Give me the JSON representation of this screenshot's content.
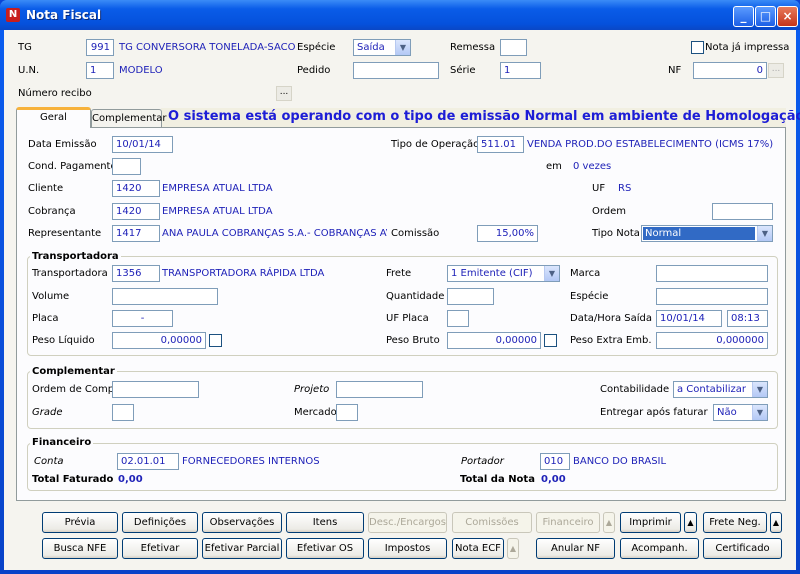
{
  "window": {
    "title": "Nota Fiscal",
    "icon": "app-logo-icon"
  },
  "header": {
    "tg_label": "TG",
    "tg_code": "991",
    "tg_name": "TG CONVERSORA TONELADA-SACO",
    "especie_label": "Espécie",
    "especie_value": "Saída",
    "remessa_label": "Remessa",
    "remessa_value": "",
    "nota_impressa_label": "Nota já impressa",
    "nota_impressa_checked": false,
    "un_label": "U.N.",
    "un_code": "1",
    "un_name": "MODELO",
    "pedido_label": "Pedido",
    "pedido_value": "",
    "serie_label": "Série",
    "serie_value": "1",
    "nf_label": "NF",
    "nf_value": "0",
    "recibo_label": "Número recibo",
    "ellipsis": "..."
  },
  "tabs": [
    {
      "label": "Geral",
      "active": true
    },
    {
      "label": "Complementar",
      "active": false
    }
  ],
  "status_message": "O sistema está operando com o tipo de emissão Normal em ambiente de Homologação",
  "geral": {
    "data_emissao_label": "Data Emissão",
    "data_emissao": "10/01/14",
    "tipo_operacao_label": "Tipo de Operação",
    "tipo_operacao_code": "511.01",
    "tipo_operacao_desc": "VENDA PROD.DO ESTABELECIMENTO (ICMS 17%)",
    "cond_pagamento_label": "Cond. Pagamento",
    "cond_pagamento": "",
    "em_label": "em",
    "vezes": "0 vezes",
    "cliente_label": "Cliente",
    "cliente_code": "1420",
    "cliente_name": "EMPRESA ATUAL LTDA",
    "uf_label": "UF",
    "uf_value": "RS",
    "cobranca_label": "Cobrança",
    "cobranca_code": "1420",
    "cobranca_name": "EMPRESA ATUAL LTDA",
    "ordem_label": "Ordem",
    "ordem_value": "",
    "representante_label": "Representante",
    "representante_code": "1417",
    "representante_name": "ANA PAULA COBRANÇAS S.A.-  COBRANÇAS AVIÂ",
    "comissao_label": "Comissão",
    "comissao_value": "15,00%",
    "tipo_nota_label": "Tipo Nota",
    "tipo_nota_value": "Normal"
  },
  "transportadora": {
    "title": "Transportadora",
    "transportadora_label": "Transportadora",
    "transportadora_code": "1356",
    "transportadora_name": "TRANSPORTADORA RÁPIDA LTDA",
    "frete_label": "Frete",
    "frete_value": "1 Emitente (CIF)",
    "marca_label": "Marca",
    "marca_value": "",
    "volume_label": "Volume",
    "volume_value": "",
    "quantidade_label": "Quantidade",
    "quantidade_value": "",
    "especie_label": "Espécie",
    "especie_value": "",
    "placa_label": "Placa",
    "placa_value": "-",
    "uf_placa_label": "UF Placa",
    "uf_placa_value": "",
    "data_hora_label": "Data/Hora Saída",
    "data_saida": "10/01/14",
    "hora_saida": "08:13",
    "peso_liquido_label": "Peso Líquido",
    "peso_liquido": "0,00000",
    "peso_bruto_label": "Peso Bruto",
    "peso_bruto": "0,00000",
    "peso_extra_label": "Peso Extra Emb.",
    "peso_extra": "0,000000"
  },
  "complementar": {
    "title": "Complementar",
    "ordem_compra_label": "Ordem de Compra",
    "ordem_compra": "",
    "projeto_label": "Projeto",
    "projeto": "",
    "contabilidade_label": "Contabilidade",
    "contabilidade": "a Contabilizar",
    "grade_label": "Grade",
    "grade": "",
    "mercado_label": "Mercado",
    "mercado": "",
    "entregar_label": "Entregar após faturar",
    "entregar": "Não"
  },
  "financeiro": {
    "title": "Financeiro",
    "conta_label": "Conta",
    "conta_code": "02.01.01",
    "conta_name": "FORNECEDORES INTERNOS",
    "portador_label": "Portador",
    "portador_code": "010",
    "portador_name": "BANCO DO BRASIL",
    "total_faturado_label": "Total Faturado",
    "total_faturado": "0,00",
    "total_nota_label": "Total da Nota",
    "total_nota": "0,00"
  },
  "buttons": [
    {
      "label": "Prévia",
      "enabled": true,
      "row": 1
    },
    {
      "label": "Definições",
      "enabled": true,
      "row": 1
    },
    {
      "label": "Observações",
      "enabled": true,
      "row": 1
    },
    {
      "label": "Itens",
      "enabled": true,
      "row": 1
    },
    {
      "label": "Desc./Encargos",
      "enabled": false,
      "row": 1
    },
    {
      "label": "Comissões",
      "enabled": false,
      "row": 1
    },
    {
      "label": "Financeiro",
      "enabled": false,
      "row": 1
    },
    {
      "label": "▲",
      "enabled": false,
      "row": 1
    },
    {
      "label": "Imprimir",
      "enabled": true,
      "row": 1
    },
    {
      "label": "▲",
      "enabled": true,
      "row": 1
    },
    {
      "label": "Frete Neg.",
      "enabled": true,
      "row": 1
    },
    {
      "label": "▲",
      "enabled": true,
      "row": 1
    },
    {
      "label": "Busca NFE",
      "enabled": true,
      "row": 2
    },
    {
      "label": "Efetivar",
      "enabled": true,
      "row": 2
    },
    {
      "label": "Efetivar Parcial",
      "enabled": true,
      "row": 2
    },
    {
      "label": "Efetivar OS",
      "enabled": true,
      "row": 2
    },
    {
      "label": "Impostos",
      "enabled": true,
      "row": 2
    },
    {
      "label": "Nota ECF",
      "enabled": true,
      "row": 2
    },
    {
      "label": "▲",
      "enabled": false,
      "row": 2
    },
    {
      "label": "Anular NF",
      "enabled": true,
      "row": 2
    },
    {
      "label": "Acompanh.",
      "enabled": true,
      "row": 2
    },
    {
      "label": "Certificado",
      "enabled": true,
      "row": 2
    }
  ]
}
